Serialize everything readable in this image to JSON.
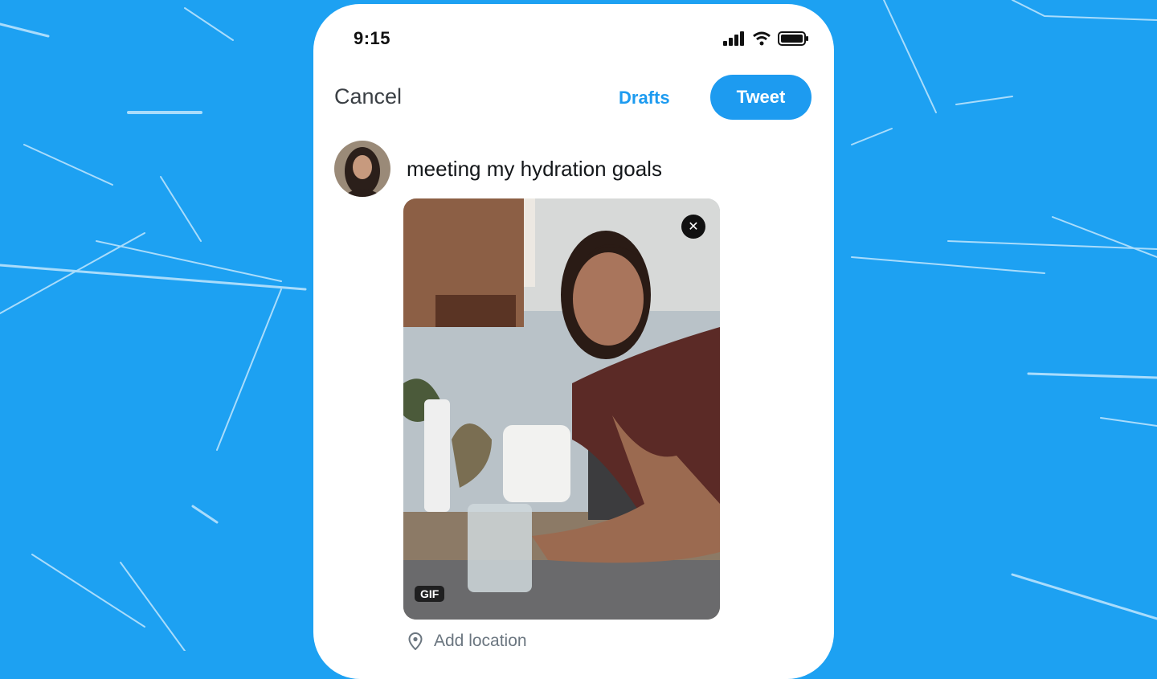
{
  "status_bar": {
    "time": "9:15",
    "icons": [
      "signal-icon",
      "wifi-icon",
      "battery-icon"
    ]
  },
  "compose": {
    "cancel_label": "Cancel",
    "drafts_label": "Drafts",
    "tweet_label": "Tweet",
    "text": "meeting my hydration goals"
  },
  "media": {
    "badge": "GIF",
    "remove_icon": "close-icon"
  },
  "location": {
    "icon": "location-pin-icon",
    "label": "Add location"
  },
  "colors": {
    "background": "#1da1f2",
    "accent": "#1d9bf0",
    "text": "#14171a"
  }
}
